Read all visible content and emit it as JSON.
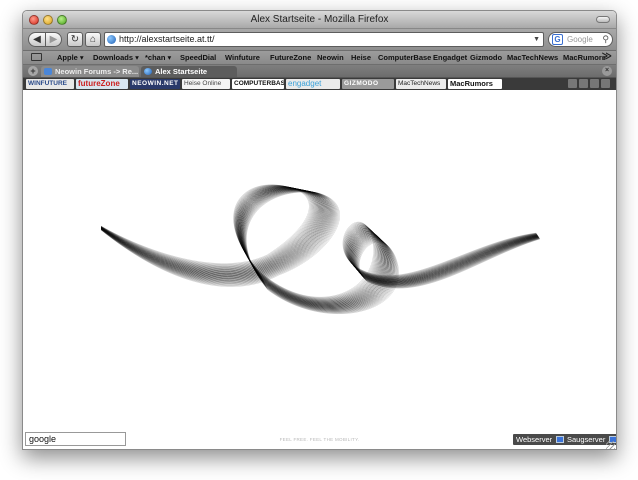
{
  "window": {
    "title": "Alex Startseite - Mozilla Firefox"
  },
  "nav": {
    "url": "http://alexstartseite.at.tt/",
    "search_placeholder": "Google",
    "back_glyph": "◀",
    "forward_glyph": "▶",
    "reload_glyph": "↻",
    "home_glyph": "⌂",
    "dropdown_glyph": "▼",
    "search_engine_glyph": "G"
  },
  "bookmarks": {
    "items": [
      "Apple ▾",
      "Downloads ▾",
      "*chan ▾",
      "SpeedDial",
      "Winfuture",
      "FutureZone",
      "Neowin",
      "Heise",
      "ComputerBase",
      "Engadget",
      "Gizmodo",
      "MacTechNews",
      "MacRumors"
    ],
    "more_glyph": "≫"
  },
  "tabs": {
    "items": [
      {
        "label": "Neowin Forums -> Re..."
      },
      {
        "label": "Alex Startseite"
      }
    ],
    "new_tab_glyph": "+",
    "close_glyph": "×"
  },
  "logos": {
    "items": [
      "WINFUTURE",
      "futureZone",
      "NEOWIN.NET",
      "Heise Online",
      "COMPUTERBASE.de",
      "engadget",
      "GIZMODO",
      "MacTechNews",
      "MacRumors"
    ]
  },
  "page": {
    "search_value": "google",
    "tagline": "FEEL FREE. FEEL THE MOBILITY.",
    "buttons": [
      "Webserver",
      "Saugserver"
    ]
  }
}
